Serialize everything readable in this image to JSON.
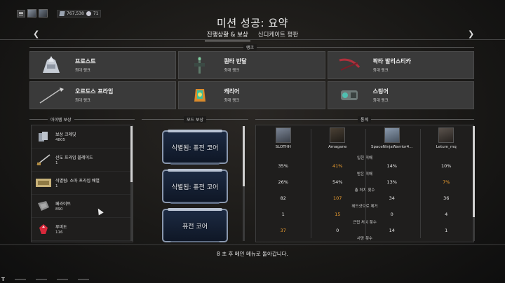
{
  "topbar": {
    "credits": "767,538",
    "platinum": "71"
  },
  "header": {
    "title": "미션 성공: 요약",
    "tabs": [
      {
        "label": "진행상황 & 보상",
        "active": true
      },
      {
        "label": "신디케이트 평판",
        "active": false
      }
    ]
  },
  "rank": {
    "section_label": "랭크",
    "cards": [
      {
        "name": "프로스트",
        "sub": "최대 랭크",
        "icon": "frost-warframe-icon"
      },
      {
        "name": "퀀타 반달",
        "sub": "최대 랭크",
        "icon": "quanta-vandal-icon"
      },
      {
        "name": "팍타 발리스티카",
        "sub": "최대 랭크",
        "icon": "paracyst-ballistica-icon"
      },
      {
        "name": "오르도스 프라임",
        "sub": "최대 랭크",
        "icon": "orthos-prime-icon"
      },
      {
        "name": "캐리어",
        "sub": "최대 랭크",
        "icon": "carrier-sentinel-icon"
      },
      {
        "name": "스팅어",
        "sub": "최대 랭크",
        "icon": "stinger-icon"
      }
    ]
  },
  "item_rewards": {
    "section_label": "아이템 보상",
    "items": [
      {
        "name": "보상 크레딧",
        "count": "4805",
        "icon": "credits-icon"
      },
      {
        "name": "신도 프라임 블레이드",
        "count": "1",
        "icon": "blade-icon"
      },
      {
        "name": "식별됨: 소마 프라임 배열",
        "count": "1",
        "icon": "blueprint-icon"
      },
      {
        "name": "페라이트",
        "count": "890",
        "icon": "ferrite-icon"
      },
      {
        "name": "루비도",
        "count": "116",
        "icon": "rubedo-icon"
      }
    ]
  },
  "mod_rewards": {
    "section_label": "모드 보상",
    "mods": [
      {
        "name": "식별됨: 퓨전 코어"
      },
      {
        "name": "식별됨: 퓨전 코어"
      },
      {
        "name": "퓨전 코어"
      }
    ]
  },
  "stats": {
    "section_label": "통계",
    "players": [
      {
        "name": "SLOTHH"
      },
      {
        "name": "Amagane"
      },
      {
        "name": "SpaceNinjaWarrior4..."
      },
      {
        "name": "Letum_mq"
      }
    ],
    "rows": [
      {
        "label": "입힌 피해",
        "values": [
          "35%",
          "41%",
          "14%",
          "10%"
        ],
        "highlight": 1
      },
      {
        "label": "받은 피해",
        "values": [
          "26%",
          "54%",
          "13%",
          "7%"
        ],
        "highlight": 3
      },
      {
        "label": "총 처치 횟수",
        "values": [
          "82",
          "107",
          "34",
          "36"
        ],
        "highlight": 1
      },
      {
        "label": "헤드샷으로 제거",
        "values": [
          "1",
          "15",
          "0",
          "4"
        ],
        "highlight": 1
      },
      {
        "label": "근접 처치 횟수",
        "values": [
          "37",
          "0",
          "14",
          "1"
        ],
        "highlight": 0
      },
      {
        "label": "사망 횟수",
        "values": [
          "",
          "",
          "",
          ""
        ],
        "highlight": -1
      }
    ]
  },
  "footer": {
    "message": "8 초 후 메인 메뉴로 돌아갑니다."
  },
  "colors": {
    "highlight": "#f0a030",
    "card_bg": "#3a3a3a",
    "mod_border": "#8a98ae"
  }
}
